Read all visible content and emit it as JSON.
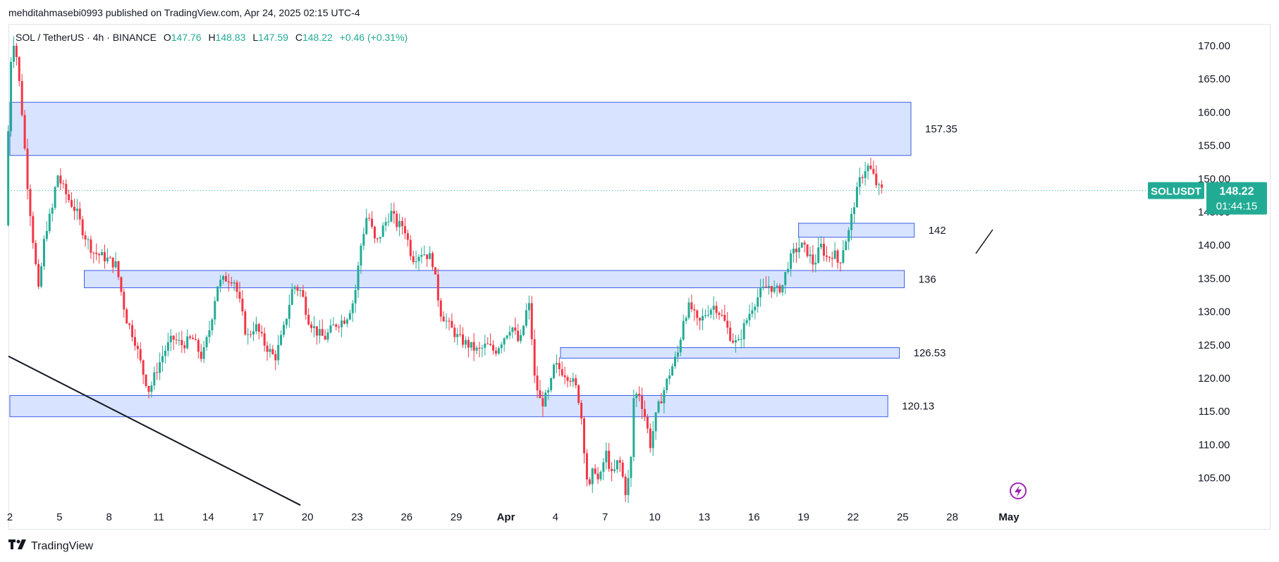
{
  "header": {
    "publish_line": "mehditahmasebi0993 published on TradingView.com, Apr 24, 2025 02:15 UTC-4"
  },
  "legend": {
    "symbol": "SOL / TetherUS · 4h · BINANCE",
    "o_label": "O",
    "o": "147.76",
    "h_label": "H",
    "h": "148.83",
    "l_label": "L",
    "l": "147.59",
    "c_label": "C",
    "c": "148.22",
    "change": "+0.46 (+0.31%)"
  },
  "footer": {
    "brand": "TradingView"
  },
  "colors": {
    "up": "#22ab94",
    "down": "#f23645",
    "zone_fill": "#d6e1ff",
    "zone_stroke": "#3b5de7",
    "badge": "#22ab94",
    "trendline": "#131722",
    "flash_icon": "#9c27b0"
  },
  "chart_data": {
    "type": "candlestick",
    "symbol": "SOLUSDT",
    "interval": "4h",
    "ylim": [
      100,
      173
    ],
    "y_ticks": [
      "170.00",
      "165.00",
      "160.00",
      "155.00",
      "150.00",
      "145.00",
      "140.00",
      "135.00",
      "130.00",
      "125.00",
      "120.00",
      "115.00",
      "110.00",
      "105.00"
    ],
    "x_ticks": [
      "2",
      "5",
      "8",
      "11",
      "14",
      "17",
      "20",
      "23",
      "26",
      "29",
      "Apr",
      "4",
      "7",
      "10",
      "13",
      "16",
      "19",
      "22",
      "25",
      "28",
      "May"
    ],
    "last_price": "148.22",
    "countdown": "01:44:15",
    "last_label": "SOLUSDT",
    "zones": [
      {
        "label": "157.35",
        "low": 153.5,
        "high": 161.5,
        "x_start": "2",
        "x_end": "Apr 25.5"
      },
      {
        "label": "142",
        "low": 141.2,
        "high": 143.3,
        "x_start": "Apr 18.7",
        "x_end": "Apr 25.7"
      },
      {
        "label": "136",
        "low": 133.6,
        "high": 136.2,
        "x_start": "Mar 6.5",
        "x_end": "Apr 25.1"
      },
      {
        "label": "126.53",
        "low": 123.0,
        "high": 124.6,
        "x_start": "Apr 4.3",
        "x_end": "Apr 24.8"
      },
      {
        "label": "120.13",
        "low": 114.2,
        "high": 117.4,
        "x_start": "2",
        "x_end": "Apr 24.1"
      }
    ],
    "trendline": {
      "from": {
        "x": "Mar 2",
        "y": 123.3
      },
      "to": {
        "x": "Mar 20",
        "y": 100.9
      }
    },
    "price_path": [
      {
        "d": 1.9,
        "p": 143
      },
      {
        "d": 2.1,
        "p": 160
      },
      {
        "d": 2.3,
        "p": 172
      },
      {
        "d": 2.6,
        "p": 168
      },
      {
        "d": 2.9,
        "p": 160
      },
      {
        "d": 3.2,
        "p": 150
      },
      {
        "d": 3.6,
        "p": 140
      },
      {
        "d": 3.9,
        "p": 133
      },
      {
        "d": 4.3,
        "p": 142
      },
      {
        "d": 4.8,
        "p": 146
      },
      {
        "d": 5.0,
        "p": 151
      },
      {
        "d": 5.3,
        "p": 149
      },
      {
        "d": 5.7,
        "p": 147
      },
      {
        "d": 6.2,
        "p": 145
      },
      {
        "d": 6.6,
        "p": 142
      },
      {
        "d": 7.2,
        "p": 139
      },
      {
        "d": 8.0,
        "p": 138
      },
      {
        "d": 8.6,
        "p": 137
      },
      {
        "d": 9.2,
        "p": 129
      },
      {
        "d": 9.7,
        "p": 126
      },
      {
        "d": 10.2,
        "p": 121
      },
      {
        "d": 10.6,
        "p": 118
      },
      {
        "d": 11.0,
        "p": 121
      },
      {
        "d": 11.5,
        "p": 124
      },
      {
        "d": 12.0,
        "p": 126
      },
      {
        "d": 12.6,
        "p": 125
      },
      {
        "d": 13.2,
        "p": 126
      },
      {
        "d": 13.8,
        "p": 123
      },
      {
        "d": 14.3,
        "p": 128
      },
      {
        "d": 14.7,
        "p": 134
      },
      {
        "d": 15.2,
        "p": 135
      },
      {
        "d": 15.7,
        "p": 135
      },
      {
        "d": 16.1,
        "p": 131
      },
      {
        "d": 16.5,
        "p": 126
      },
      {
        "d": 17.0,
        "p": 128
      },
      {
        "d": 17.6,
        "p": 125
      },
      {
        "d": 18.2,
        "p": 123
      },
      {
        "d": 18.7,
        "p": 127
      },
      {
        "d": 19.3,
        "p": 134
      },
      {
        "d": 19.8,
        "p": 133
      },
      {
        "d": 20.2,
        "p": 129
      },
      {
        "d": 20.7,
        "p": 127
      },
      {
        "d": 21.2,
        "p": 126
      },
      {
        "d": 21.8,
        "p": 128
      },
      {
        "d": 22.5,
        "p": 129
      },
      {
        "d": 23.0,
        "p": 132
      },
      {
        "d": 23.4,
        "p": 140
      },
      {
        "d": 23.8,
        "p": 145
      },
      {
        "d": 24.3,
        "p": 140
      },
      {
        "d": 24.8,
        "p": 143
      },
      {
        "d": 25.2,
        "p": 145
      },
      {
        "d": 25.6,
        "p": 143
      },
      {
        "d": 26.0,
        "p": 143
      },
      {
        "d": 26.5,
        "p": 138
      },
      {
        "d": 27.1,
        "p": 139
      },
      {
        "d": 27.7,
        "p": 138
      },
      {
        "d": 28.2,
        "p": 130
      },
      {
        "d": 28.7,
        "p": 128
      },
      {
        "d": 29.3,
        "p": 126
      },
      {
        "d": 29.9,
        "p": 125
      },
      {
        "d": 30.5,
        "p": 124
      },
      {
        "d": 31.0,
        "p": 125
      },
      {
        "d": 31.5,
        "p": 124
      },
      {
        "d": 32.0,
        "p": 126
      },
      {
        "d": 32.5,
        "p": 128
      },
      {
        "d": 33.0,
        "p": 125
      },
      {
        "d": 33.4,
        "p": 130
      },
      {
        "d": 33.6,
        "p": 131
      },
      {
        "d": 33.9,
        "p": 120
      },
      {
        "d": 34.3,
        "p": 116
      },
      {
        "d": 34.8,
        "p": 118
      },
      {
        "d": 35.1,
        "p": 122
      },
      {
        "d": 35.6,
        "p": 121
      },
      {
        "d": 36.1,
        "p": 120
      },
      {
        "d": 36.5,
        "p": 118
      },
      {
        "d": 36.8,
        "p": 113
      },
      {
        "d": 37.0,
        "p": 106
      },
      {
        "d": 37.2,
        "p": 103
      },
      {
        "d": 37.5,
        "p": 107
      },
      {
        "d": 37.8,
        "p": 104
      },
      {
        "d": 38.2,
        "p": 109
      },
      {
        "d": 38.6,
        "p": 105
      },
      {
        "d": 39.0,
        "p": 108
      },
      {
        "d": 39.4,
        "p": 103
      },
      {
        "d": 39.7,
        "p": 106
      },
      {
        "d": 39.9,
        "p": 117
      },
      {
        "d": 40.2,
        "p": 118
      },
      {
        "d": 40.6,
        "p": 114
      },
      {
        "d": 40.9,
        "p": 110
      },
      {
        "d": 41.3,
        "p": 115
      },
      {
        "d": 41.7,
        "p": 118
      },
      {
        "d": 42.1,
        "p": 121
      },
      {
        "d": 42.6,
        "p": 124
      },
      {
        "d": 42.9,
        "p": 129
      },
      {
        "d": 43.3,
        "p": 131
      },
      {
        "d": 43.8,
        "p": 128
      },
      {
        "d": 44.3,
        "p": 130
      },
      {
        "d": 44.8,
        "p": 131
      },
      {
        "d": 45.3,
        "p": 129
      },
      {
        "d": 45.8,
        "p": 126
      },
      {
        "d": 46.2,
        "p": 125
      },
      {
        "d": 46.6,
        "p": 128
      },
      {
        "d": 47.1,
        "p": 131
      },
      {
        "d": 47.6,
        "p": 133
      },
      {
        "d": 48.1,
        "p": 134
      },
      {
        "d": 48.5,
        "p": 133
      },
      {
        "d": 48.9,
        "p": 134
      },
      {
        "d": 49.2,
        "p": 137
      },
      {
        "d": 49.6,
        "p": 139
      },
      {
        "d": 50.0,
        "p": 140
      },
      {
        "d": 50.4,
        "p": 139
      },
      {
        "d": 50.8,
        "p": 137
      },
      {
        "d": 51.2,
        "p": 140
      },
      {
        "d": 51.6,
        "p": 138
      },
      {
        "d": 52.0,
        "p": 139
      },
      {
        "d": 52.3,
        "p": 137
      },
      {
        "d": 52.6,
        "p": 140
      },
      {
        "d": 52.9,
        "p": 142
      },
      {
        "d": 53.2,
        "p": 146
      },
      {
        "d": 53.6,
        "p": 150
      },
      {
        "d": 54.0,
        "p": 152
      },
      {
        "d": 54.3,
        "p": 151
      },
      {
        "d": 54.6,
        "p": 149
      },
      {
        "d": 54.8,
        "p": 148.22
      }
    ]
  }
}
